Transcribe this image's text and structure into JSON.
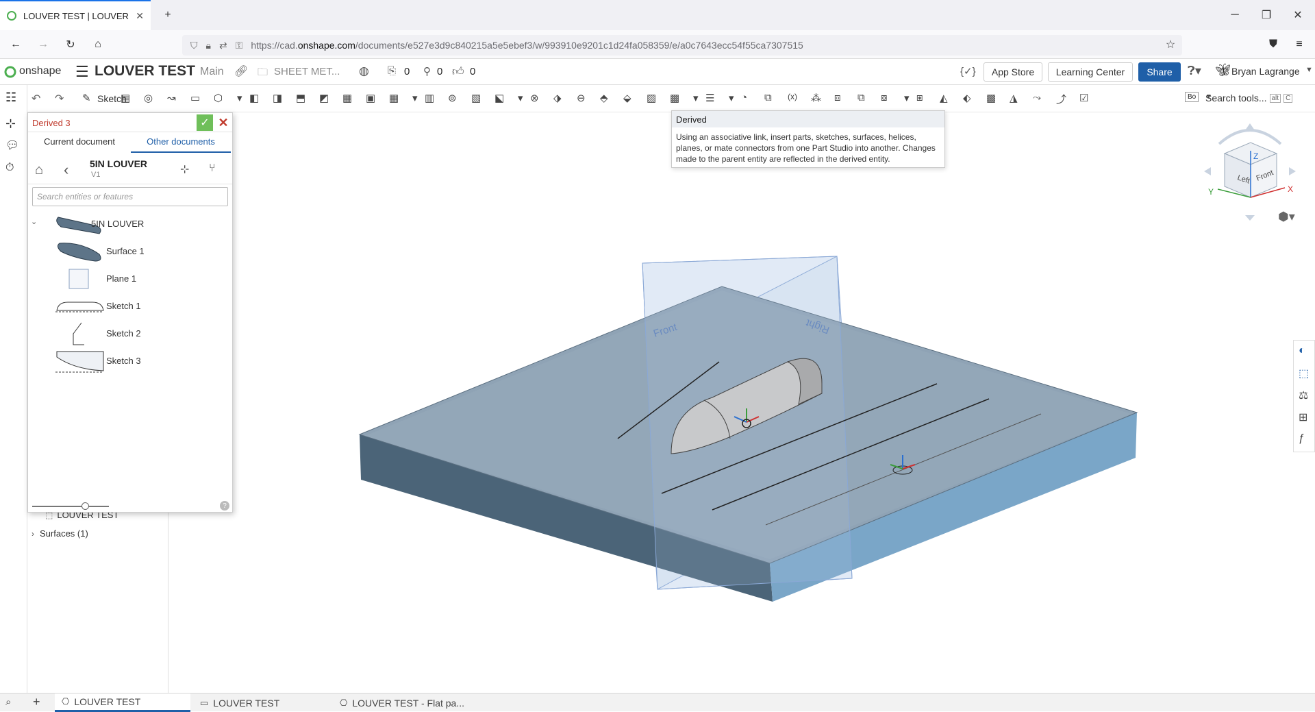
{
  "browser": {
    "tab_title": "LOUVER TEST | LOUVER TEST",
    "url_prefix": "https://cad.",
    "url_domain": "onshape.com",
    "url_path": "/documents/e527e3d9c840215a5e5ebef3/w/993910e9201c1d24fa058359/e/a0c7643ecc54f55ca7307515"
  },
  "header": {
    "brand": "onshape",
    "doc_title": "LOUVER TEST",
    "branch": "Main",
    "folder": "SHEET MET...",
    "counts": [
      "0",
      "0",
      "0"
    ],
    "var_icon": "{✓}",
    "app_store": "App Store",
    "learning_center": "Learning Center",
    "share": "Share",
    "user": "Bryan Lagrange"
  },
  "toolbar": {
    "sketch_label": "Sketch",
    "search_tools": "Search tools...",
    "shortcut_alt": "alt",
    "shortcut_key": "C",
    "bo_label": "Bo"
  },
  "dialog": {
    "title": "Derived 3",
    "tab_current": "Current document",
    "tab_other": "Other documents",
    "doc_name": "5IN LOUVER",
    "doc_version": "V1",
    "search_placeholder": "Search entities or features",
    "entities": [
      {
        "label": "5IN LOUVER"
      },
      {
        "label": "Surface 1"
      },
      {
        "label": "Plane 1"
      },
      {
        "label": "Sketch 1"
      },
      {
        "label": "Sketch 2"
      },
      {
        "label": "Sketch 3"
      }
    ],
    "help": "?"
  },
  "feature_list": {
    "parts_item": "LOUVER TEST",
    "surfaces_item": "Surfaces (1)"
  },
  "tooltip": {
    "title": "Derived",
    "body": "Using an associative link, insert parts, sketches, surfaces, helices, planes, or mate connectors from one Part Studio into another. Changes made to the parent entity are reflected in the derived entity."
  },
  "viewport": {
    "plane_front": "Front",
    "plane_right": "Right",
    "cube_left": "Left",
    "cube_front": "Front",
    "axis_x": "X",
    "axis_y": "Y",
    "axis_z": "Z"
  },
  "bottom_tabs": [
    {
      "label": "LOUVER TEST"
    },
    {
      "label": "LOUVER TEST"
    },
    {
      "label": "LOUVER TEST - Flat pa..."
    }
  ],
  "colors": {
    "accent": "#1f5fa8",
    "dialog_title": "#c0392b",
    "part_top": "#8fa3b5",
    "part_side": "#4b6478",
    "confirm": "#6fbf5a"
  }
}
